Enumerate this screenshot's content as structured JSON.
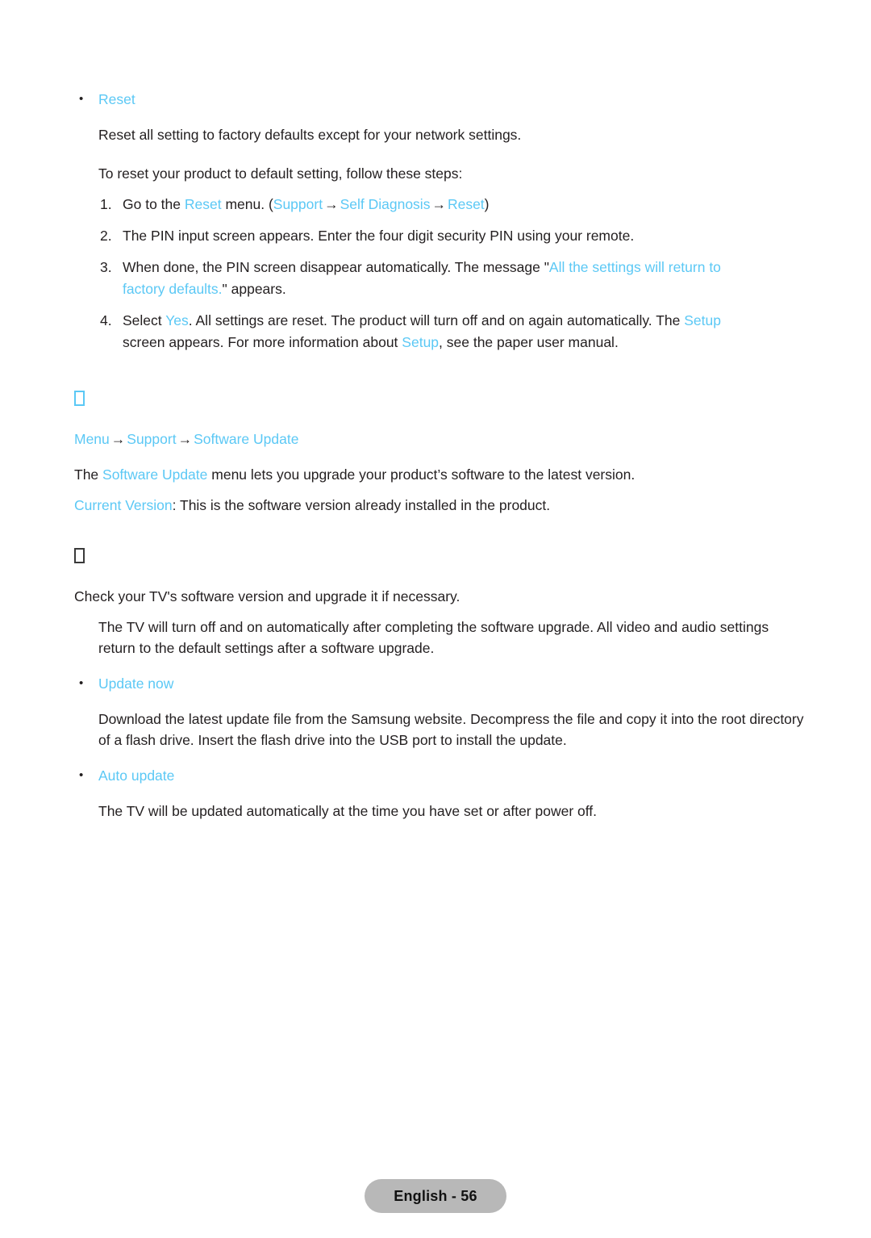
{
  "reset_section": {
    "bullet_label": "Reset",
    "description": "Reset all setting to factory defaults except for your network settings.",
    "steps_intro": "To reset your product to default setting, follow these steps:",
    "steps": [
      {
        "marker": "1.",
        "part1": "Go to the ",
        "link1": "Reset",
        "part2": " menu. (",
        "link2": "Support",
        "arrow1": "→",
        "link3": "Self Diagnosis",
        "arrow2": "→",
        "link4": "Reset",
        "part3": ")"
      },
      {
        "marker": "2.",
        "text": "The PIN input screen appears. Enter the four digit security PIN using your remote."
      },
      {
        "marker": "3.",
        "part1": "When done, the PIN screen disappear automatically. The message \"",
        "link1": "All the settings will return to factory defaults.",
        "part2": "\" appears."
      },
      {
        "marker": "4.",
        "part1": "Select ",
        "link1": "Yes",
        "part2": ". All settings are reset. The product will turn off and on again automatically. The ",
        "link2": "Setup",
        "part3": " screen appears. For more information about ",
        "link3": "Setup",
        "part4": ", see the paper user manual."
      }
    ]
  },
  "software_update_section": {
    "heading_glyph": "□",
    "path": {
      "item1": "Menu",
      "arrow1": "→",
      "item2": "Support",
      "arrow2": "→",
      "item3": "Software Update"
    },
    "intro_part1": "The ",
    "intro_link": "Software Update",
    "intro_part2": " menu lets you upgrade your product’s software to the latest version.",
    "current_version_link": "Current Version",
    "current_version_text": ": This is the software version already installed in the product."
  },
  "update_now_section": {
    "heading_glyph": "□",
    "lead": "Check your TV's software version and upgrade it if necessary.",
    "note": "The TV will turn off and on automatically after completing the software upgrade. All video and audio settings return to the default settings after a software upgrade.",
    "update_now_label": "Update now",
    "update_now_text": "Download the latest update file from the Samsung website. Decompress the file and copy it into the root directory of a flash drive. Insert the flash drive into the USB port to install the update.",
    "auto_update_label": "Auto update",
    "auto_update_text": "The TV will be updated automatically at the time you have set or after power off."
  },
  "footer": {
    "page_label": "English - 56"
  },
  "colors": {
    "accent": "#5bc8f5",
    "text": "#231f20",
    "footer_pill": "#b8b8b8"
  }
}
